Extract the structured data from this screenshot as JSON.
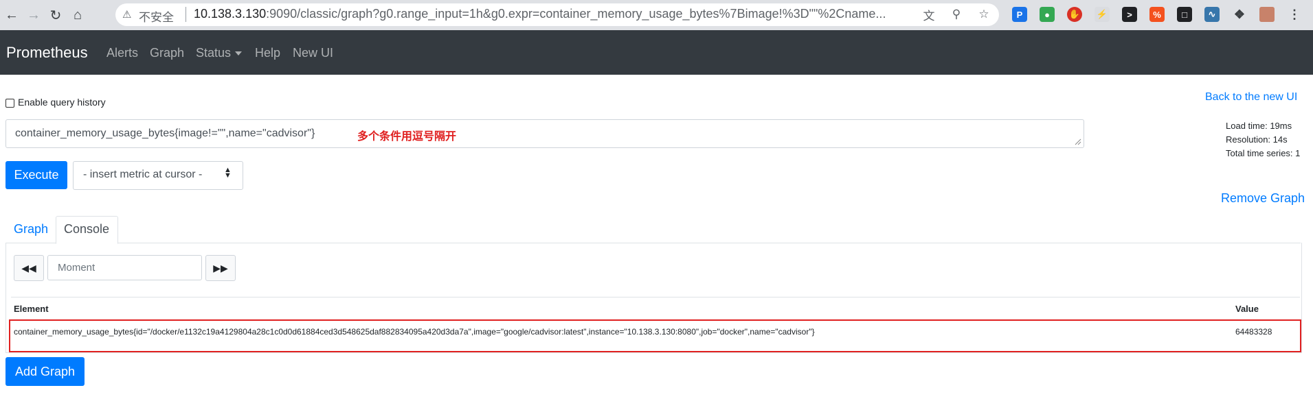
{
  "browser": {
    "insecure_label": "不安全",
    "url_host": "10.138.3.130",
    "url_rest": ":9090/classic/graph?g0.range_input=1h&g0.expr=container_memory_usage_bytes%7Bimage!%3D\"\"%2Cname..."
  },
  "navbar": {
    "brand": "Prometheus",
    "links": [
      "Alerts",
      "Graph",
      "Status",
      "Help",
      "New UI"
    ]
  },
  "page": {
    "query_history_label": "Enable query history",
    "back_link": "Back to the new UI",
    "expression": "container_memory_usage_bytes{image!=\"\",name=\"cadvisor\"}",
    "annotation": "多个条件用逗号隔开",
    "stats": {
      "load_time": "Load time: 19ms",
      "resolution": "Resolution: 14s",
      "total_series": "Total time series: 1"
    },
    "execute_label": "Execute",
    "insert_metric_label": "- insert metric at cursor -",
    "remove_graph_label": "Remove Graph"
  },
  "tabs": {
    "graph": "Graph",
    "console": "Console"
  },
  "console": {
    "moment_placeholder": "Moment",
    "columns": [
      "Element",
      "Value"
    ],
    "rows": [
      {
        "element": "container_memory_usage_bytes{id=\"/docker/e1132c19a4129804a28c1c0d0d61884ced3d548625daf882834095a420d3da7a\",image=\"google/cadvisor:latest\",instance=\"10.138.3.130:8080\",job=\"docker\",name=\"cadvisor\"}",
        "value": "64483328"
      }
    ]
  },
  "add_graph_label": "Add Graph",
  "colors": {
    "primary": "#007bff",
    "navbar": "#343a40",
    "highlight": "#e02020"
  }
}
